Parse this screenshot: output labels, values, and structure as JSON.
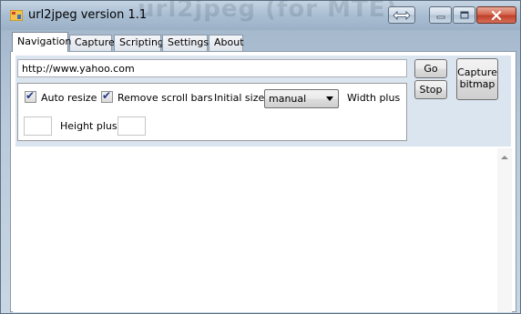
{
  "window": {
    "title": "url2jpeg version 1.1",
    "watermark": "url2jpeg (for MTE)"
  },
  "tabs": [
    {
      "label": "Navigation",
      "active": true
    },
    {
      "label": "Capture"
    },
    {
      "label": "Scripting"
    },
    {
      "label": "Settings"
    },
    {
      "label": "About"
    }
  ],
  "navigation": {
    "url_value": "http://www.yahoo.com",
    "go_label": "Go",
    "stop_label": "Stop",
    "capture_label": "Capture bitmap",
    "auto_resize_label": "Auto resize",
    "auto_resize_checked": true,
    "remove_scroll_label": "Remove scroll bars",
    "remove_scroll_checked": true,
    "initial_size_label": "Initial size",
    "initial_size_value": "manual",
    "width_plus_label": "Width plus",
    "width_plus_value": "",
    "height_plus_label": "Height plus",
    "height_plus_value": ""
  },
  "colors": {
    "accent": "#21398a",
    "close_button": "#c0412a",
    "panel_background": "#dbe5f0"
  },
  "icons": [
    "app-icon",
    "restore-size-icon",
    "minimize-icon",
    "maximize-icon",
    "close-icon",
    "checkmark-icon",
    "dropdown-arrow-icon",
    "scroll-up-arrow-icon"
  ]
}
